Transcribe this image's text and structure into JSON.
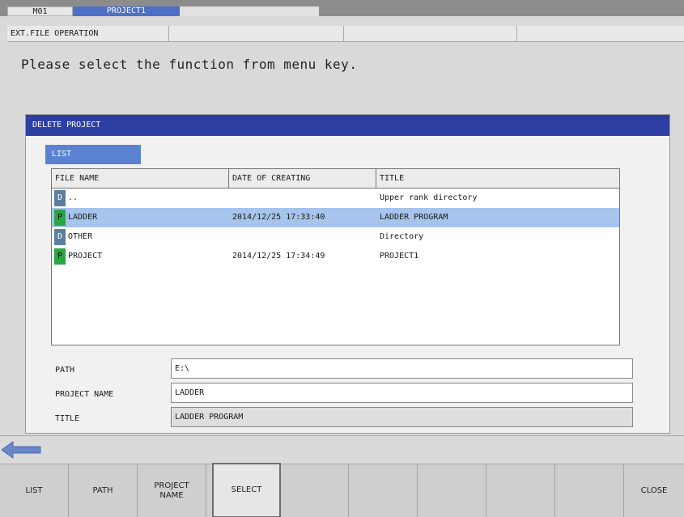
{
  "header": {
    "mode": "M01",
    "project": "PROJECT1",
    "screen_title": "EXT.FILE OPERATION"
  },
  "message": "Please select the function from menu key.",
  "dialog": {
    "title": "DELETE PROJECT",
    "list_tab": "LIST",
    "columns": [
      "FILE NAME",
      "DATE OF CREATING",
      "TITLE"
    ],
    "rows": [
      {
        "type": "D",
        "name": "..",
        "date": "",
        "title": "Upper rank directory"
      },
      {
        "type": "P",
        "name": "LADDER",
        "date": "2014/12/25 17:33:40",
        "title": "LADDER PROGRAM"
      },
      {
        "type": "D",
        "name": "OTHER",
        "date": "",
        "title": "Directory"
      },
      {
        "type": "P",
        "name": "PROJECT",
        "date": "2014/12/25 17:34:49",
        "title": "PROJECT1"
      }
    ],
    "fields": {
      "path_label": "PATH",
      "path_value": "E:\\",
      "project_name_label": "PROJECT NAME",
      "project_name_value": "LADDER",
      "title_label": "TITLE",
      "title_value": "LADDER PROGRAM"
    }
  },
  "menu": {
    "keys": [
      "LIST",
      "PATH",
      "PROJECT\nNAME",
      "SELECT",
      "",
      "",
      "",
      "",
      "",
      "CLOSE"
    ]
  },
  "icons": {
    "back": "left-arrow-icon"
  },
  "colors": {
    "accent_blue": "#2e3fa3",
    "tab_blue": "#5b82d2",
    "selected_row": "#a6c4ec",
    "badge_p": "#29a542",
    "badge_d": "#5b7f9f"
  }
}
